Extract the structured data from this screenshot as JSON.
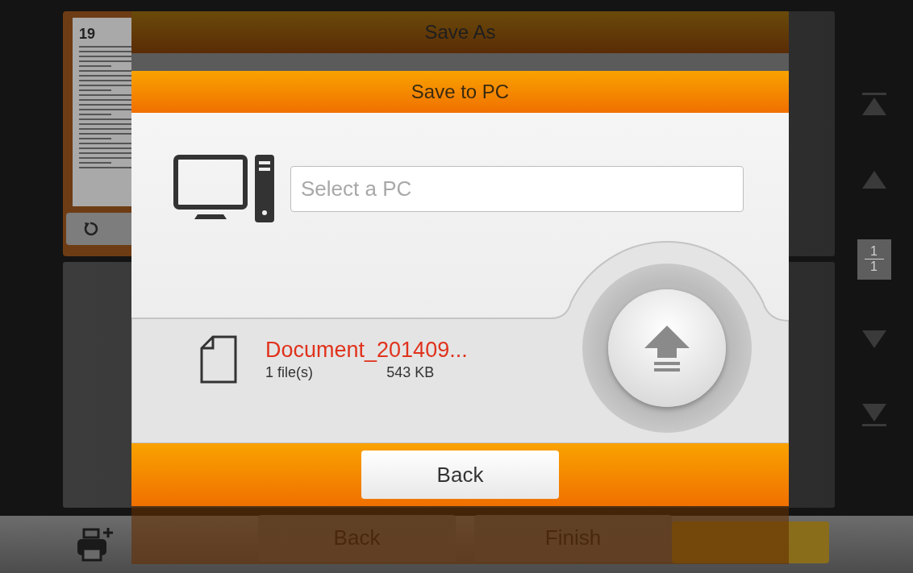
{
  "background": {
    "thumbnail": {
      "page_number": "19"
    },
    "page_indicator": {
      "current": "1",
      "total": "1"
    },
    "toolbar_buttons": [
      {
        "label": "Back"
      },
      {
        "label": "Finish"
      }
    ]
  },
  "save_as": {
    "title": "Save As"
  },
  "dialog": {
    "title": "Save to PC",
    "pc_field": {
      "placeholder": "Select a PC"
    },
    "file": {
      "name": "Document_201409...",
      "count": "1 file(s)",
      "size": "543 KB"
    },
    "back_button": "Back"
  }
}
